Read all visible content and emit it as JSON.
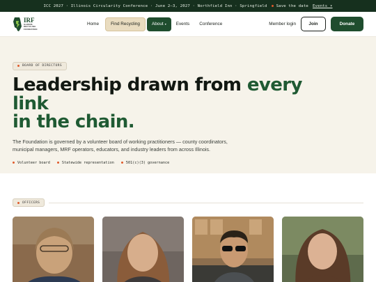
{
  "announcement": {
    "text": "ICC 2027 · Illinois Circularity Conference · June 2–3, 2027 · Northfield Inn · Springfield",
    "save_date": "Save the date",
    "events_link": "Events ▾"
  },
  "header": {
    "logo": {
      "mark": "IRF",
      "line1": "ILLINOIS",
      "line2": "RECYCLING",
      "line3": "FOUNDATION"
    },
    "nav": [
      {
        "label": "Home"
      },
      {
        "label": "Find Recycling"
      },
      {
        "label": "About"
      },
      {
        "label": "Events"
      },
      {
        "label": "Conference"
      }
    ],
    "member_login": "Member login",
    "join": "Join",
    "donate": "Donate"
  },
  "hero": {
    "tag": "BOARD OF DIRECTORS",
    "headline_main": "Leadership drawn from ",
    "headline_accent_1": "every link",
    "headline_accent_2": "in the chain.",
    "lede": "The Foundation is governed by a volunteer board of working practitioners — county coordinators, municipal managers, MRF operators, educators, and industry leaders from across Illinois.",
    "points": [
      "Volunteer board",
      "Statewide representation",
      "501(c)(3) governance"
    ]
  },
  "officers": {
    "tag": "OFFICERS",
    "photos": [
      "portrait-photo-1",
      "portrait-photo-2",
      "portrait-photo-3",
      "portrait-photo-4"
    ]
  },
  "colors": {
    "brand_green": "#1f4d2e",
    "accent_orange": "#e05a2b",
    "hero_bg": "#f6f3ea",
    "topbar_bg": "#16301e"
  }
}
